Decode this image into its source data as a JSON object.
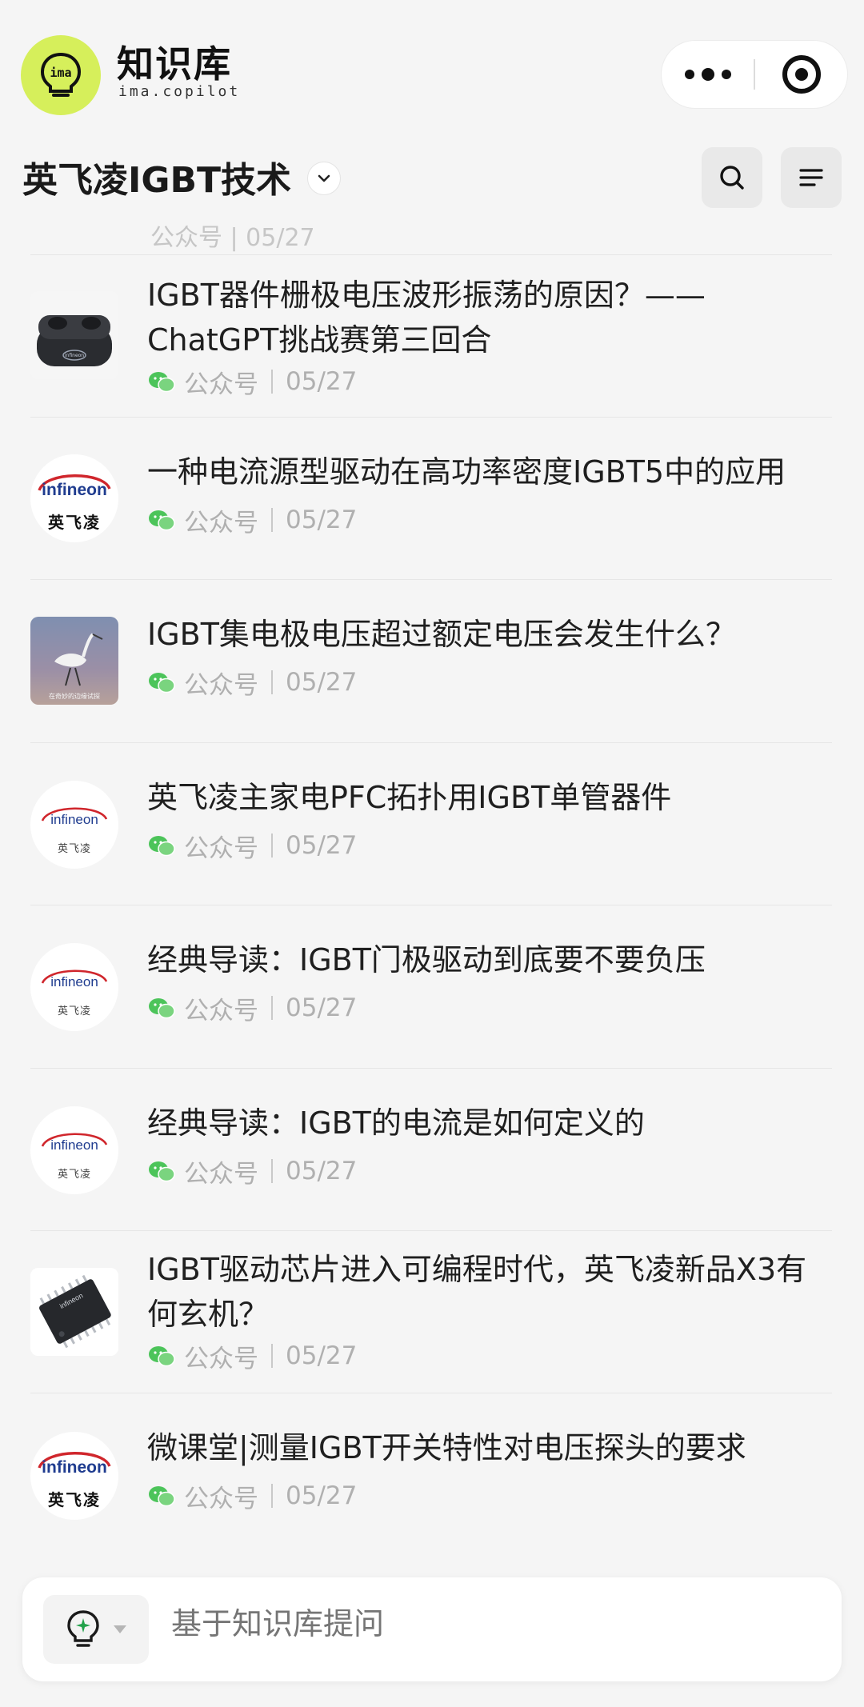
{
  "brand": {
    "logo_text": "ima",
    "title": "知识库",
    "subtitle": "ima.copilot"
  },
  "capsule": {
    "more_icon": "ellipsis-icon",
    "close_icon": "target-icon"
  },
  "kb": {
    "title": "英飞凌IGBT技术",
    "chevron_icon": "chevron-down-icon",
    "search_icon": "search-icon",
    "menu_icon": "menu-lines-icon"
  },
  "list": {
    "peek_text": "公众号 | 05/27",
    "items": [
      {
        "title": "IGBT器件栅极电压波形振荡的原因？—— ChatGPT挑战赛第三回合",
        "source": "公众号",
        "date": "05/27",
        "thumb": "earbuds-photo"
      },
      {
        "title": "一种电流源型驱动在高功率密度IGBT5中的应用",
        "source": "公众号",
        "date": "05/27",
        "thumb": "infineon-logo",
        "logo_word": "infineon",
        "logo_cn": "英飞凌"
      },
      {
        "title": "IGBT集电极电压超过额定电压会发生什么？",
        "source": "公众号",
        "date": "05/27",
        "thumb": "bird-photo",
        "thumb_caption": "在奇妙的边缘试探"
      },
      {
        "title": "英飞凌主家电PFC拓扑用IGBT单管器件",
        "source": "公众号",
        "date": "05/27",
        "thumb": "infineon-logo",
        "logo_word": "infineon",
        "logo_cn": "英飞凌"
      },
      {
        "title": "经典导读：IGBT门极驱动到底要不要负压",
        "source": "公众号",
        "date": "05/27",
        "thumb": "infineon-logo",
        "logo_word": "infineon",
        "logo_cn": "英飞凌"
      },
      {
        "title": "经典导读：IGBT的电流是如何定义的",
        "source": "公众号",
        "date": "05/27",
        "thumb": "infineon-logo",
        "logo_word": "infineon",
        "logo_cn": "英飞凌"
      },
      {
        "title": "IGBT驱动芯片进入可编程时代，英飞凌新品X3有何玄机？",
        "source": "公众号",
        "date": "05/27",
        "thumb": "chip-photo",
        "logo_word": "infineon"
      },
      {
        "title": "微课堂|测量IGBT开关特性对电压探头的要求",
        "source": "公众号",
        "date": "05/27",
        "thumb": "infineon-logo",
        "logo_word": "infineon",
        "logo_cn": "英飞凌"
      }
    ]
  },
  "ask": {
    "model_icon": "lightbulb-icon",
    "placeholder": "基于知识库提问"
  },
  "colors": {
    "background": "#f5f5f5",
    "brand_green": "#d6ef5b",
    "wechat_green": "#4cc45a",
    "infineon_blue": "#1f3c8f",
    "infineon_red": "#d0262c",
    "meta_gray": "#b0b0b0"
  }
}
